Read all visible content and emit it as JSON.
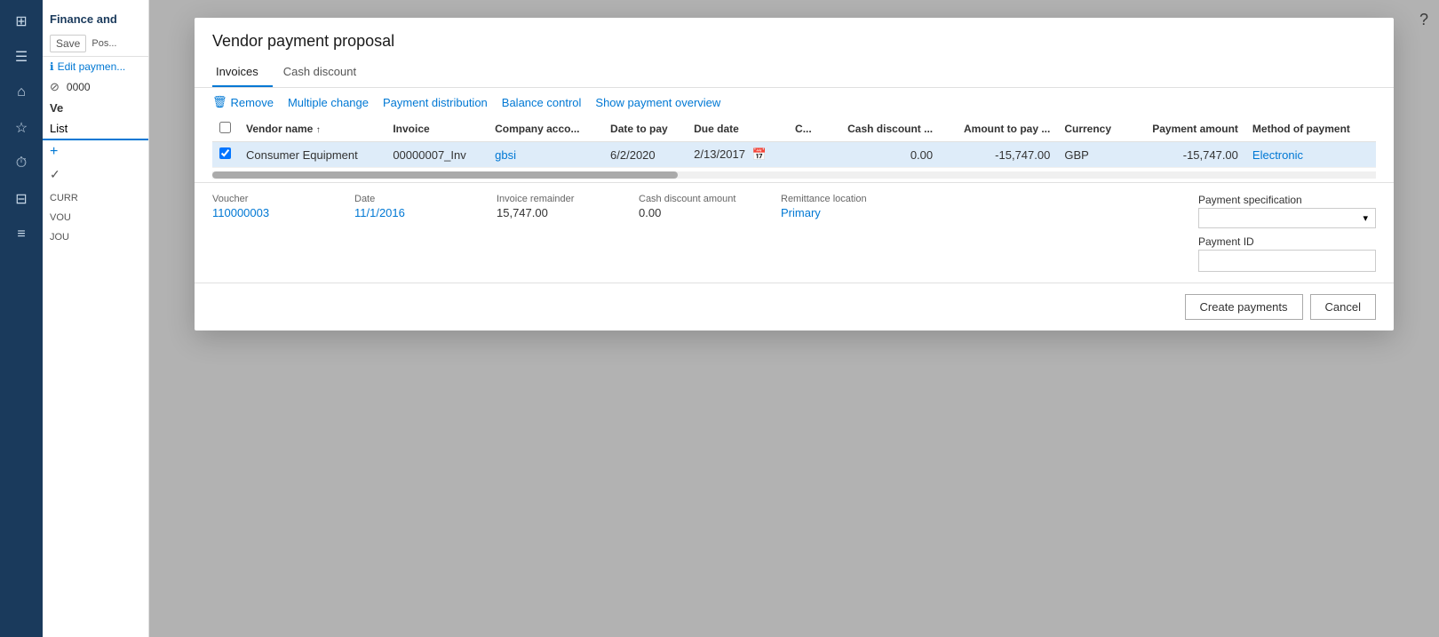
{
  "app": {
    "title": "Finance and",
    "help_icon": "?"
  },
  "nav": {
    "icons": [
      "⊞",
      "☰",
      "⌂",
      "★",
      "⏱",
      "⊟",
      "≡"
    ]
  },
  "toolbar": {
    "save_label": "Save",
    "post_label": "Post",
    "edit_payment_label": "Edit payment..."
  },
  "sidebar": {
    "id_prefix": "0000",
    "title_prefix": "Ve",
    "list_label": "List",
    "add_icon": "+",
    "check_icon": "✓",
    "curr_label": "CURR",
    "vouc_label": "VOU",
    "jour_label": "JOU"
  },
  "dialog": {
    "title": "Vendor payment proposal",
    "tabs": [
      {
        "id": "invoices",
        "label": "Invoices",
        "active": true
      },
      {
        "id": "cash_discount",
        "label": "Cash discount",
        "active": false
      }
    ],
    "actions": [
      {
        "id": "remove",
        "label": "Remove",
        "icon": "🗑"
      },
      {
        "id": "multiple_change",
        "label": "Multiple change"
      },
      {
        "id": "payment_distribution",
        "label": "Payment distribution"
      },
      {
        "id": "balance_control",
        "label": "Balance control"
      },
      {
        "id": "show_payment_overview",
        "label": "Show payment overview"
      }
    ],
    "table": {
      "columns": [
        {
          "id": "checkbox",
          "label": ""
        },
        {
          "id": "vendor_name",
          "label": "Vendor name"
        },
        {
          "id": "invoice",
          "label": "Invoice"
        },
        {
          "id": "company_account",
          "label": "Company acco..."
        },
        {
          "id": "date_to_pay",
          "label": "Date to pay"
        },
        {
          "id": "due_date",
          "label": "Due date"
        },
        {
          "id": "c",
          "label": "C..."
        },
        {
          "id": "cash_discount",
          "label": "Cash discount ..."
        },
        {
          "id": "amount_to_pay",
          "label": "Amount to pay ..."
        },
        {
          "id": "currency",
          "label": "Currency"
        },
        {
          "id": "payment_amount",
          "label": "Payment amount"
        },
        {
          "id": "method_of_payment",
          "label": "Method of payment"
        }
      ],
      "rows": [
        {
          "selected": true,
          "vendor_name": "Consumer Equipment",
          "invoice": "00000007_Inv",
          "company_account": "gbsi",
          "date_to_pay": "6/2/2020",
          "due_date": "2/13/2017",
          "c": "",
          "cash_discount": "0.00",
          "amount_to_pay": "-15,747.00",
          "currency": "GBP",
          "payment_amount": "-15,747.00",
          "method_of_payment": "Electronic"
        }
      ]
    },
    "details": {
      "voucher_label": "Voucher",
      "voucher_value": "110000003",
      "date_label": "Date",
      "date_value": "11/1/2016",
      "invoice_remainder_label": "Invoice remainder",
      "invoice_remainder_value": "15,747.00",
      "cash_discount_amount_label": "Cash discount amount",
      "cash_discount_amount_value": "0.00",
      "remittance_location_label": "Remittance location",
      "remittance_location_value": "Primary",
      "payment_specification_label": "Payment specification",
      "payment_specification_placeholder": "",
      "payment_id_label": "Payment ID"
    },
    "footer": {
      "create_payments_label": "Create payments",
      "cancel_label": "Cancel"
    }
  }
}
